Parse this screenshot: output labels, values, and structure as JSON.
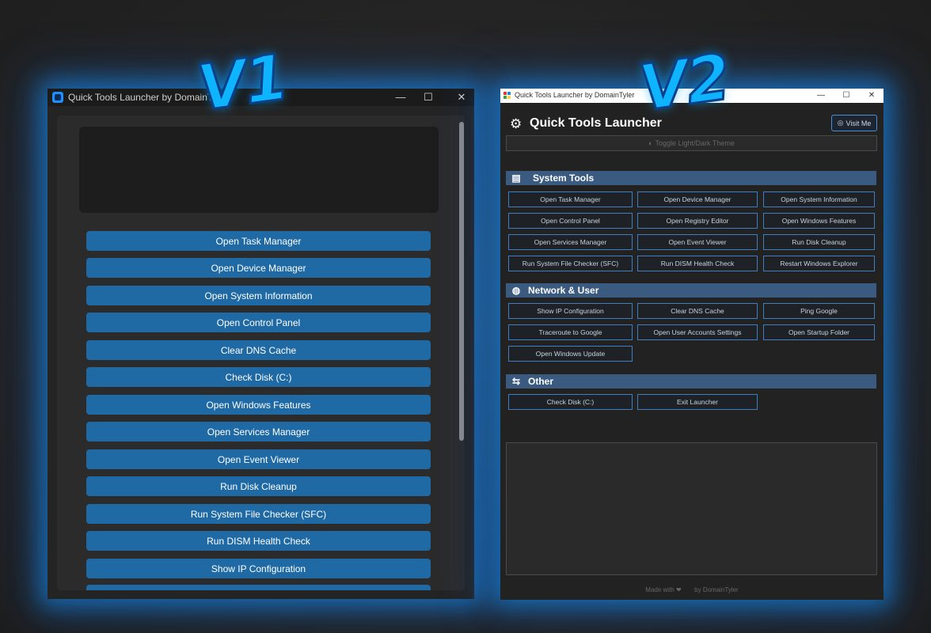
{
  "v1": {
    "title": "Quick Tools Launcher by DomainTyler",
    "controls": {
      "minimize": "—",
      "maximize": "☐",
      "close": "✕"
    },
    "buttons": [
      "Open Task Manager",
      "Open Device Manager",
      "Open System Information",
      "Open Control Panel",
      "Clear DNS Cache",
      "Check Disk (C:)",
      "Open Windows Features",
      "Open Services Manager",
      "Open Event Viewer",
      "Run Disk Cleanup",
      "Run System File Checker (SFC)",
      "Run DISM Health Check",
      "Show IP Configuration"
    ]
  },
  "v2": {
    "window_title": "Quick Tools Launcher by DomainTyler",
    "controls": {
      "minimize": "—",
      "maximize": "☐",
      "close": "✕"
    },
    "header_title": "Quick Tools Launcher",
    "visit_label": "Visit Me",
    "toggle_label": "Toggle Light/Dark Theme",
    "sections": {
      "system": {
        "title": "System Tools",
        "buttons": [
          "Open Task Manager",
          "Open Device Manager",
          "Open System Information",
          "Open Control Panel",
          "Open Registry Editor",
          "Open Windows Features",
          "Open Services Manager",
          "Open Event Viewer",
          "Run Disk Cleanup",
          "Run System File Checker (SFC)",
          "Run DISM Health Check",
          "Restart Windows Explorer"
        ]
      },
      "network": {
        "title": "Network & User",
        "buttons": [
          "Show IP Configuration",
          "Clear DNS Cache",
          "Ping Google",
          "Traceroute to Google",
          "Open User Accounts Settings",
          "Open Startup Folder",
          "Open Windows Update"
        ]
      },
      "other": {
        "title": "Other",
        "buttons": [
          "Check Disk (C:)",
          "Exit Launcher"
        ]
      }
    },
    "footer": {
      "made_with": "Made with ❤",
      "by": "by DomainTyler"
    }
  },
  "badges": {
    "v1": "V1",
    "v2": "V2"
  },
  "colors": {
    "accent_glow": "#1496ff",
    "v1_button": "#1f6aa5",
    "v2_section": "#3a5a80",
    "v2_button_border": "#3f7fbf"
  }
}
